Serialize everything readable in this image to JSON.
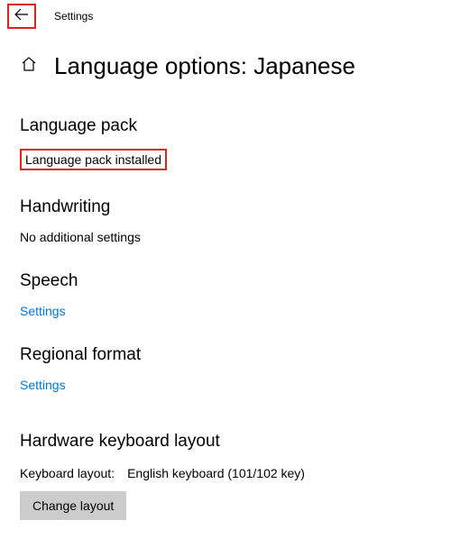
{
  "topbar": {
    "app_title": "Settings"
  },
  "header": {
    "page_title": "Language options: Japanese"
  },
  "sections": {
    "language_pack": {
      "heading": "Language pack",
      "status": "Language pack installed"
    },
    "handwriting": {
      "heading": "Handwriting",
      "status": "No additional settings"
    },
    "speech": {
      "heading": "Speech",
      "link": "Settings"
    },
    "regional": {
      "heading": "Regional format",
      "link": "Settings"
    },
    "hardware": {
      "heading": "Hardware keyboard layout",
      "label": "Keyboard layout:",
      "value": "English keyboard (101/102 key)",
      "button": "Change layout"
    }
  }
}
